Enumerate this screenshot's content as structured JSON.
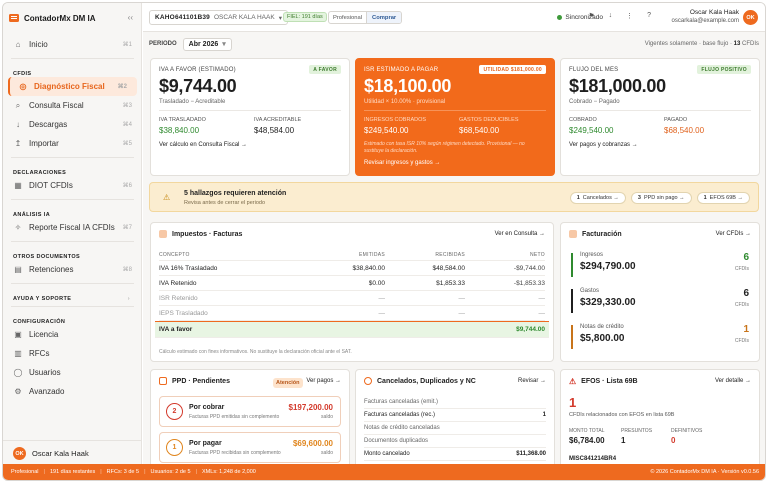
{
  "app": {
    "name": "ContadorMx DM IA",
    "collapse_icon": "‹‹"
  },
  "sidebar": {
    "items_top": [
      {
        "icon": "⌂",
        "label": "Inicio",
        "kbd": "⌘1"
      }
    ],
    "sections": [
      {
        "title": "CFDIS",
        "items": [
          {
            "icon": "◎",
            "label": "Diagnóstico Fiscal",
            "kbd": "⌘2",
            "active": true
          },
          {
            "icon": "⌕",
            "label": "Consulta Fiscal",
            "kbd": "⌘3"
          },
          {
            "icon": "↓",
            "label": "Descargas",
            "kbd": "⌘4"
          },
          {
            "icon": "↥",
            "label": "Importar",
            "kbd": "⌘5"
          }
        ]
      },
      {
        "title": "DECLARACIONES",
        "items": [
          {
            "icon": "▦",
            "label": "DIOT CFDIs",
            "kbd": "⌘6"
          }
        ]
      },
      {
        "title": "ANÁLISIS IA",
        "items": [
          {
            "icon": "✧",
            "label": "Reporte Fiscal IA CFDIs",
            "kbd": "⌘7"
          }
        ]
      },
      {
        "title": "OTROS DOCUMENTOS",
        "items": [
          {
            "icon": "▤",
            "label": "Retenciones",
            "kbd": "⌘8"
          }
        ]
      },
      {
        "title": "AYUDA Y SOPORTE",
        "items": [],
        "chevron": "›"
      },
      {
        "title": "CONFIGURACIÓN",
        "items": [
          {
            "icon": "▣",
            "label": "Licencia"
          },
          {
            "icon": "▥",
            "label": "RFCs"
          },
          {
            "icon": "◯",
            "label": "Usuarios"
          },
          {
            "icon": "⚙",
            "label": "Avanzado"
          }
        ]
      }
    ],
    "user": {
      "initials": "OK",
      "name": "Oscar Kala Haak"
    }
  },
  "topbar": {
    "rfc": "KAHO641101B39",
    "client_name": "OSCAR KALA HAAK",
    "caret": "▾",
    "fiel_badge": "FIEL: 191 días",
    "plan_label": "Profesional",
    "plan_action": "Comprar",
    "sync_label": "Sincronizado",
    "icons": [
      "⚑",
      "↓",
      "⋮",
      "?"
    ],
    "user_name": "Oscar Kala Haak",
    "user_email": "oscarkala@example.com",
    "user_initials": "OK"
  },
  "period": {
    "label": "PERIODO",
    "value": "Abr 2026",
    "caret": "▾",
    "note_prefix": "Vigentes solamente · base flujo ·",
    "note_count": "13",
    "note_suffix": "CFDIs"
  },
  "kpis": {
    "iva": {
      "label": "IVA A FAVOR (ESTIMADO)",
      "badge": "A FAVOR",
      "value": "$9,744.00",
      "subtitle": "Trasladado − Acreditable",
      "col1_label": "IVA TRASLADADO",
      "col1_value": "$38,840.00",
      "col2_label": "IVA ACREDITABLE",
      "col2_value": "$48,584.00",
      "link": "Ver cálculo en Consulta Fiscal →"
    },
    "isr": {
      "label": "ISR ESTIMADO A PAGAR",
      "badge": "UTILIDAD $181,000.00",
      "value": "$18,100.00",
      "subtitle": "Utilidad × 10.00% · provisional",
      "col1_label": "INGRESOS COBRADOS",
      "col1_value": "$249,540.00",
      "col2_label": "GASTOS DEDUCIBLES",
      "col2_value": "$68,540.00",
      "note": "Estimado con tasa ISR 10% según régimen detectado. Provisional — no sustituye la declaración.",
      "link": "Revisar ingresos y gastos →"
    },
    "flujo": {
      "label": "FLUJO DEL MES",
      "badge": "FLUJO POSITIVO",
      "value": "$181,000.00",
      "subtitle": "Cobrado − Pagado",
      "col1_label": "COBRADO",
      "col1_value": "$249,540.00",
      "col2_label": "PAGADO",
      "col2_value": "$68,540.00",
      "link": "Ver pagos y cobranzas →"
    }
  },
  "alert": {
    "icon": "⚠",
    "title": "5 hallazgos requieren atención",
    "subtitle": "Revisa antes de cerrar el periodo",
    "chips": [
      {
        "count": "1",
        "label": "Cancelados →"
      },
      {
        "count": "3",
        "label": "PPD sin pago →"
      },
      {
        "count": "1",
        "label": "EFOS 69B →"
      }
    ]
  },
  "impuestos": {
    "title": "Impuestos · Facturas",
    "action": "Ver en Consulta →",
    "headers": [
      "CONCEPTO",
      "EMITIDAS",
      "RECIBIDAS",
      "NETO"
    ],
    "rows": [
      {
        "c": "IVA 16% Trasladado",
        "e": "$38,840.00",
        "r": "$48,584.00",
        "n": "-$9,744.00",
        "muted": false
      },
      {
        "c": "IVA Retenido",
        "e": "$0.00",
        "r": "$1,853.33",
        "n": "-$1,853.33",
        "muted": false
      },
      {
        "c": "ISR Retenido",
        "e": "—",
        "r": "—",
        "n": "—",
        "muted": true
      },
      {
        "c": "IEPS Trasladado",
        "e": "—",
        "r": "—",
        "n": "—",
        "muted": true
      }
    ],
    "total": {
      "c": "IVA a favor",
      "n": "$9,744.00"
    },
    "footnote": "Cálculo estimado con fines informativos. No sustituye la declaración oficial ante el SAT."
  },
  "facturacion": {
    "title": "Facturación",
    "action": "Ver CFDIs →",
    "rows": [
      {
        "label": "Ingresos",
        "value": "$294,790.00",
        "count": "6",
        "count_label": "CFDIs",
        "color": "#2f8a2f"
      },
      {
        "label": "Gastos",
        "value": "$329,330.00",
        "count": "6",
        "count_label": "CFDIs",
        "color": "#1f1f1f"
      },
      {
        "label": "Notas de crédito",
        "value": "$5,800.00",
        "count": "1",
        "count_label": "CFDIs",
        "color": "#c8741a"
      }
    ]
  },
  "ppd": {
    "title": "PPD · Pendientes",
    "badge": "Atención",
    "action": "Ver pagos →",
    "items": [
      {
        "count": "2",
        "title": "Por cobrar",
        "subtitle": "Facturas PPD emitidas sin complemento",
        "amount": "$197,200.00",
        "amount_label": "saldo",
        "color": "#d33a2c"
      },
      {
        "count": "1",
        "title": "Por pagar",
        "subtitle": "Facturas PPD recibidas sin complemento",
        "amount": "$69,600.00",
        "amount_label": "saldo",
        "color": "#e0861f"
      }
    ]
  },
  "cancelados": {
    "title": "Cancelados, Duplicados y NC",
    "action": "Revisar →",
    "rows": [
      {
        "label": "Facturas canceladas (emit.)",
        "value": "",
        "dark": false
      },
      {
        "label": "Facturas canceladas (rec.)",
        "value": "1",
        "dark": true
      },
      {
        "label": "Notas de crédito canceladas",
        "value": "",
        "dark": false
      },
      {
        "label": "Documentos duplicados",
        "value": "",
        "dark": false
      },
      {
        "label": "Monto cancelado",
        "value": "$11,368.00",
        "dark": true
      }
    ]
  },
  "efos": {
    "title": "EFOS · Lista 69B",
    "action": "Ver detalle →",
    "count": "1",
    "subtitle": "CFDIs relacionados con EFOS en lista 69B",
    "cols": [
      {
        "label": "MONTO TOTAL",
        "value": "$6,784.00"
      },
      {
        "label": "PRESUNTOS",
        "value": "1"
      },
      {
        "label": "DEFINITIVOS",
        "value": "0"
      }
    ],
    "rfc": "MISC841214BR4"
  },
  "statusbar": {
    "items": [
      "Profesional",
      "191 días restantes",
      "RFCs: 3 de 5",
      "Usuarios: 2 de 5",
      "XMLs: 1,248 de 2,000"
    ],
    "version": "© 2026 ContadorMx DM IA · Versión v0.0.56"
  },
  "colors": {
    "accent": "#ee6a1f",
    "green": "#2f8a2f",
    "red": "#d33a2c"
  }
}
